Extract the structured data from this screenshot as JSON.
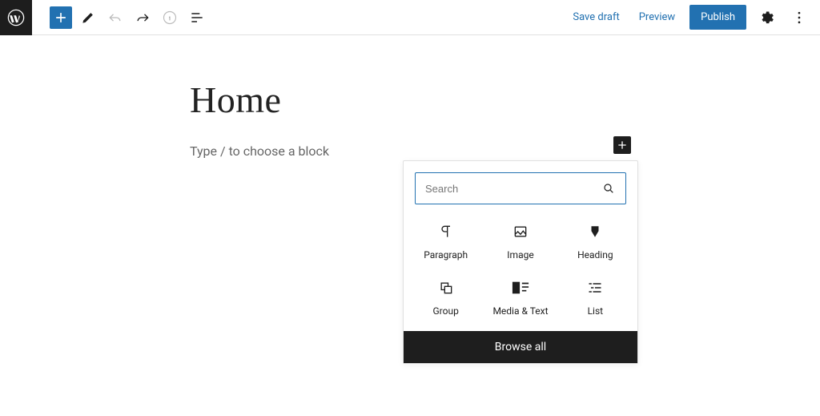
{
  "topbar": {
    "save_draft": "Save draft",
    "preview": "Preview",
    "publish": "Publish"
  },
  "editor": {
    "title": "Home",
    "block_placeholder": "Type / to choose a block"
  },
  "inserter": {
    "search_placeholder": "Search",
    "browse_all": "Browse all",
    "blocks": [
      {
        "label": "Paragraph"
      },
      {
        "label": "Image"
      },
      {
        "label": "Heading"
      },
      {
        "label": "Group"
      },
      {
        "label": "Media & Text"
      },
      {
        "label": "List"
      }
    ]
  }
}
